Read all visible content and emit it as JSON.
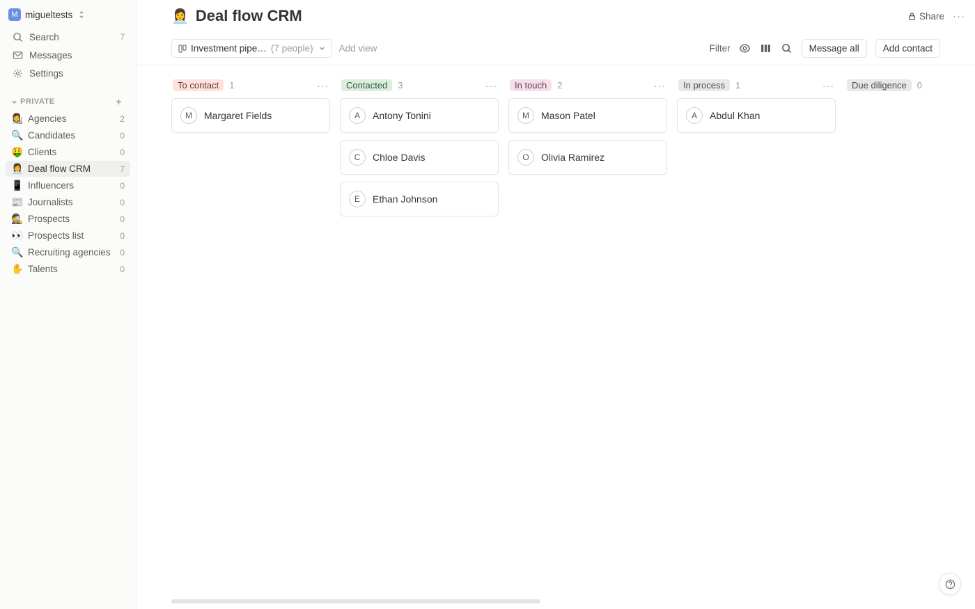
{
  "workspace": {
    "avatar_initial": "M",
    "name": "migueltests"
  },
  "nav": {
    "search": {
      "label": "Search",
      "count": "7"
    },
    "messages": {
      "label": "Messages"
    },
    "settings": {
      "label": "Settings"
    }
  },
  "private_section": {
    "label": "PRIVATE"
  },
  "pages": [
    {
      "emoji": "👩‍🎨",
      "label": "Agencies",
      "count": "2",
      "selected": false
    },
    {
      "emoji": "🔍",
      "label": "Candidates",
      "count": "0",
      "selected": false
    },
    {
      "emoji": "🤑",
      "label": "Clients",
      "count": "0",
      "selected": false
    },
    {
      "emoji": "👩‍💼",
      "label": "Deal flow CRM",
      "count": "7",
      "selected": true
    },
    {
      "emoji": "📱",
      "label": "Influencers",
      "count": "0",
      "selected": false
    },
    {
      "emoji": "📰",
      "label": "Journalists",
      "count": "0",
      "selected": false
    },
    {
      "emoji": "🕵️",
      "label": "Prospects",
      "count": "0",
      "selected": false
    },
    {
      "emoji": "👀",
      "label": "Prospects list",
      "count": "0",
      "selected": false
    },
    {
      "emoji": "🔍",
      "label": "Recruiting agencies",
      "count": "0",
      "selected": false
    },
    {
      "emoji": "✋",
      "label": "Talents",
      "count": "0",
      "selected": false
    }
  ],
  "page": {
    "emoji": "👩‍💼",
    "title": "Deal flow CRM"
  },
  "topbar": {
    "share": "Share"
  },
  "toolbar": {
    "view_label": "Investment pipe…",
    "view_count": "(7 people)",
    "add_view": "Add view",
    "filter": "Filter",
    "message_all": "Message all",
    "add_contact": "Add contact"
  },
  "columns": [
    {
      "label": "To contact",
      "count": "1",
      "pill": "pill-red",
      "cards": [
        {
          "initial": "M",
          "name": "Margaret Fields"
        }
      ]
    },
    {
      "label": "Contacted",
      "count": "3",
      "pill": "pill-green",
      "cards": [
        {
          "initial": "A",
          "name": "Antony Tonini"
        },
        {
          "initial": "C",
          "name": "Chloe Davis"
        },
        {
          "initial": "E",
          "name": "Ethan Johnson"
        }
      ]
    },
    {
      "label": "In touch",
      "count": "2",
      "pill": "pill-pink",
      "cards": [
        {
          "initial": "M",
          "name": "Mason Patel"
        },
        {
          "initial": "O",
          "name": "Olivia Ramirez"
        }
      ]
    },
    {
      "label": "In process",
      "count": "1",
      "pill": "pill-gray",
      "cards": [
        {
          "initial": "A",
          "name": "Abdul Khan"
        }
      ]
    },
    {
      "label": "Due diligence",
      "count": "0",
      "pill": "pill-gray",
      "cards": []
    }
  ]
}
